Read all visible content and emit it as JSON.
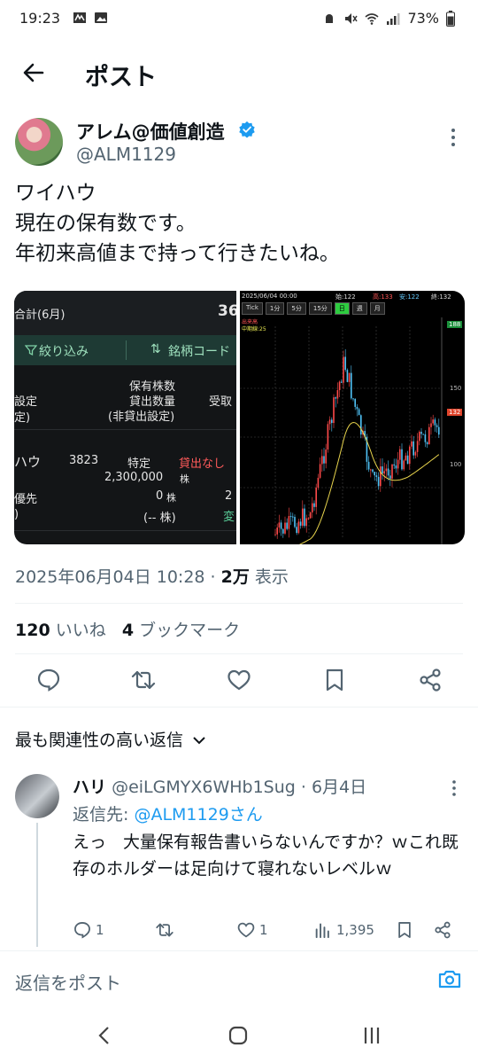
{
  "status_bar": {
    "time": "19:23",
    "battery": "73%"
  },
  "header": {
    "title": "ポスト"
  },
  "post": {
    "author_name": "アレム@価値創造",
    "author_handle": "@ALM1129",
    "text": "ワイハウ\n現在の保有数です。\n年初来高値まで持って行きたいね。",
    "timestamp": "2025年06月04日 10:28",
    "views_value": "2万",
    "views_label": "表示",
    "likes_count": "120",
    "likes_label": "いいね",
    "bookmarks_count": "4",
    "bookmarks_label": "ブックマーク"
  },
  "left_image": {
    "header_label": "合計(6月)",
    "header_value": "36",
    "filter_label": "絞り込み",
    "sort_label": "銘柄コード",
    "col1_a": "設定",
    "col1_b": "定)",
    "col2_a": "保有株数",
    "col2_b": "貸出数量",
    "col2_c": "(非貸出設定)",
    "col3": "受取",
    "stock_name": "ハウ",
    "stock_code": "3823",
    "account_type": "特定",
    "lending_status": "貸出なし",
    "shares": "2,300,000",
    "shares_unit": "株",
    "priority_label": "優先",
    "zero_shares": "0",
    "zero_unit": "株",
    "paren_label": ")",
    "paren_value": "(-- 株)",
    "right_fragment_a": "2",
    "right_fragment_b": "変"
  },
  "right_image": {
    "date": "2025/06/04 00:00",
    "open_label": "始:122",
    "high_label": "高:133",
    "low_label": "安:122",
    "close_label": "終:132",
    "tabs": [
      "Tick",
      "1分",
      "5分",
      "15分",
      "日",
      "週",
      "月"
    ],
    "active_tab": "日",
    "legend_a": "出来高",
    "legend_b": "中期線:25",
    "price_labels": [
      "188",
      "150",
      "132",
      "100"
    ]
  },
  "sort_label": "最も関連性の高い返信",
  "reply": {
    "name": "ハリ",
    "handle_date": "@eiLGMYX6WHb1Sug · 6月4日",
    "reply_to_label": "返信先:",
    "reply_to_handle": "@ALM1129さん",
    "text": "えっ　大量保有報告書いらないんですか？ｗこれ既存のホルダーは足向けて寝れないレベルｗ",
    "reply_count": "1",
    "like_count": "1",
    "views_count": "1,395"
  },
  "compose": {
    "placeholder": "返信をポスト"
  },
  "colors": {
    "accent": "#1d9bf0",
    "text": "#0f1419",
    "secondary": "#536471"
  }
}
